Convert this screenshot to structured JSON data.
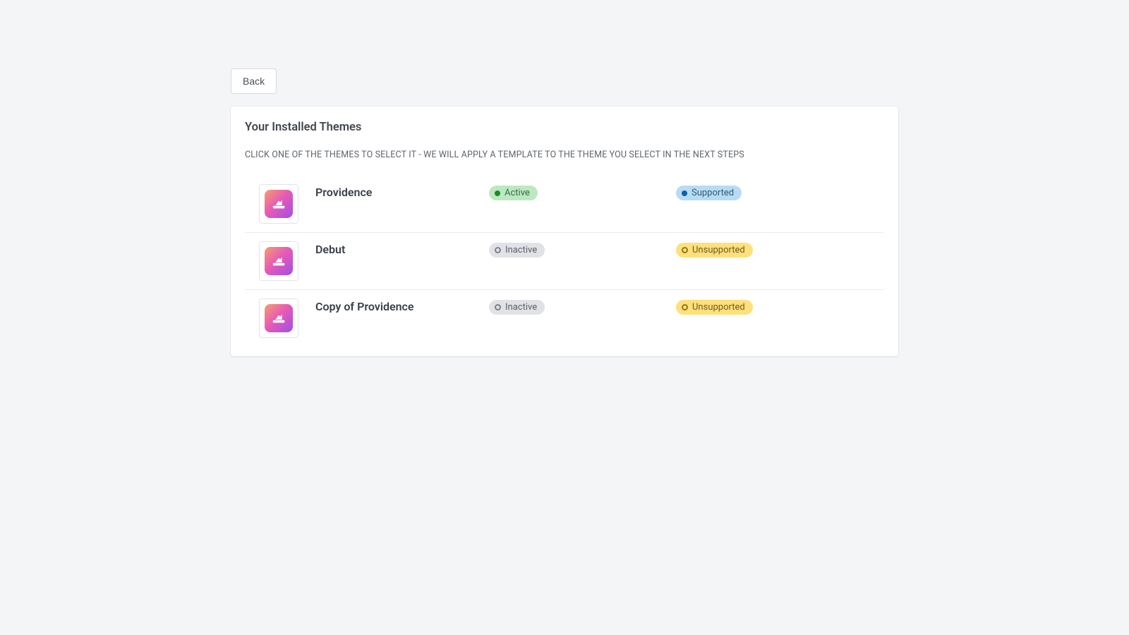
{
  "back_button": "Back",
  "card": {
    "title": "Your Installed Themes",
    "subtitle": "CLICK ONE OF THE THEMES TO SELECT IT - WE WILL APPLY A TEMPLATE TO THE THEME YOU SELECT IN THE NEXT STEPS"
  },
  "themes": [
    {
      "name": "Providence",
      "status_label": "Active",
      "status_type": "active",
      "support_label": "Supported",
      "support_type": "supported"
    },
    {
      "name": "Debut",
      "status_label": "Inactive",
      "status_type": "inactive",
      "support_label": "Unsupported",
      "support_type": "unsupported"
    },
    {
      "name": "Copy of Providence",
      "status_label": "Inactive",
      "status_type": "inactive",
      "support_label": "Unsupported",
      "support_type": "unsupported"
    }
  ]
}
